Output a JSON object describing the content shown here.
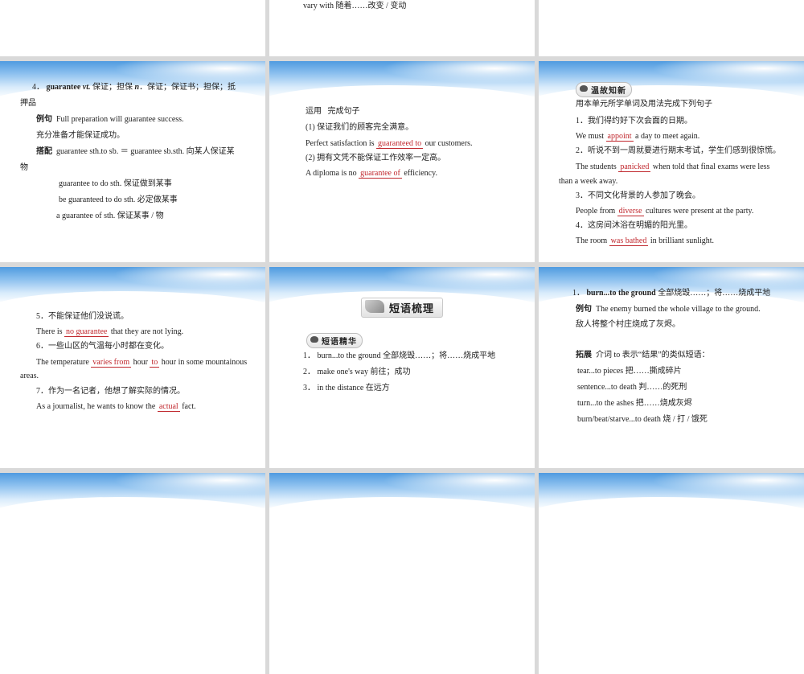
{
  "s0": {
    "t": "vary with  随着……改变 / 变动"
  },
  "s1": {
    "l1_num": "4．",
    "l1_word": "guarantee",
    "l1_pos1": "vt.",
    "l1_m1": " 保证；担保  ",
    "l1_pos2": "n",
    "l1_m2": "．保证；保证书；担保；抵",
    "l2": "押品",
    "l3_label": "例句",
    "l3": "Full preparation will guarantee success.",
    "l4": "充分准备才能保证成功。",
    "l5_label": "搭配",
    "l5": "guarantee sth.to sb. ＝ guarantee sb.sth.  向某人保证某",
    "l6": "物",
    "l7": "guarantee to do sth. 保证做到某事",
    "l8": "be guaranteed to do sth. 必定做某事",
    "l9": "a guarantee of sth. 保证某事 / 物"
  },
  "s2": {
    "l1_label": "运用",
    "l1": "完成句子",
    "l2": "(1) 保证我们的顾客完全满意。",
    "l3a": "Perfect satisfaction is ",
    "l3ans": "guaranteed to",
    "l3b": " our customers.",
    "l4": "(2) 拥有文凭不能保证工作效率一定高。",
    "l5a": "A diploma is no ",
    "l5ans": "guarantee of",
    "l5b": " efficiency."
  },
  "s3": {
    "tag": "温故知新",
    "l1": "用本单元所学单词及用法完成下列句子",
    "l2": "1．我们得约好下次会面的日期。",
    "l3a": "We must ",
    "l3ans": "appoint",
    "l3b": " a day to meet again.",
    "l4": "2．听说不到一周就要进行期末考试，学生们感到很惊慌。",
    "l5a": "The students ",
    "l5ans": "panicked",
    "l5b": " when told that final exams were less",
    "l6": "than a week away.",
    "l7": "3．不同文化背景的人参加了晚会。",
    "l8a": "People from ",
    "l8ans": "diverse",
    "l8b": " cultures were present at the party.",
    "l9": "4．这房间沐浴在明媚的阳光里。",
    "l10a": "The room ",
    "l10ans": "was bathed",
    "l10b": " in brilliant sunlight."
  },
  "s4": {
    "l1": "5．不能保证他们没说谎。",
    "l2a": "There is ",
    "l2ans": "no guarantee",
    "l2b": " that they are not lying.",
    "l3": "6．一些山区的气温每小时都在变化。",
    "l4a": "The temperature ",
    "l4ans1": "varies from",
    "l4b": " hour ",
    "l4ans2": "to",
    "l4c": " hour in some mountainous",
    "l5": "areas.",
    "l6": "7．作为一名记者，他想了解实际的情况。",
    "l7a": "As a journalist, he wants to know the ",
    "l7ans": "actual",
    "l7b": " fact."
  },
  "s5": {
    "banner": "短语梳理",
    "tag": "短语精华",
    "l1": "1．  burn...to the ground   全部烧毁……；将……烧成平地",
    "l2": "2．  make one's way  前往；成功",
    "l3": "3．  in the distance   在远方"
  },
  "s6": {
    "l1_num": "1．",
    "l1_phrase": "burn...to the ground",
    "l1_m": "  全部烧毁……；将……烧成平地",
    "l2_label": "例句",
    "l2": "The enemy burned the whole village to the ground.",
    "l3": "敌人将整个村庄烧成了灰烬。",
    "l4_label": "拓展",
    "l4": "介词   to  表示“结果”的类似短语：",
    "l5": "tear...to pieces   把……撕成碎片",
    "l6": "sentence...to death  判……的死刑",
    "l7": "turn...to the ashes  把……烧成灰烬",
    "l8": "burn/beat/starve...to death  烧 / 打 / 饿死"
  }
}
